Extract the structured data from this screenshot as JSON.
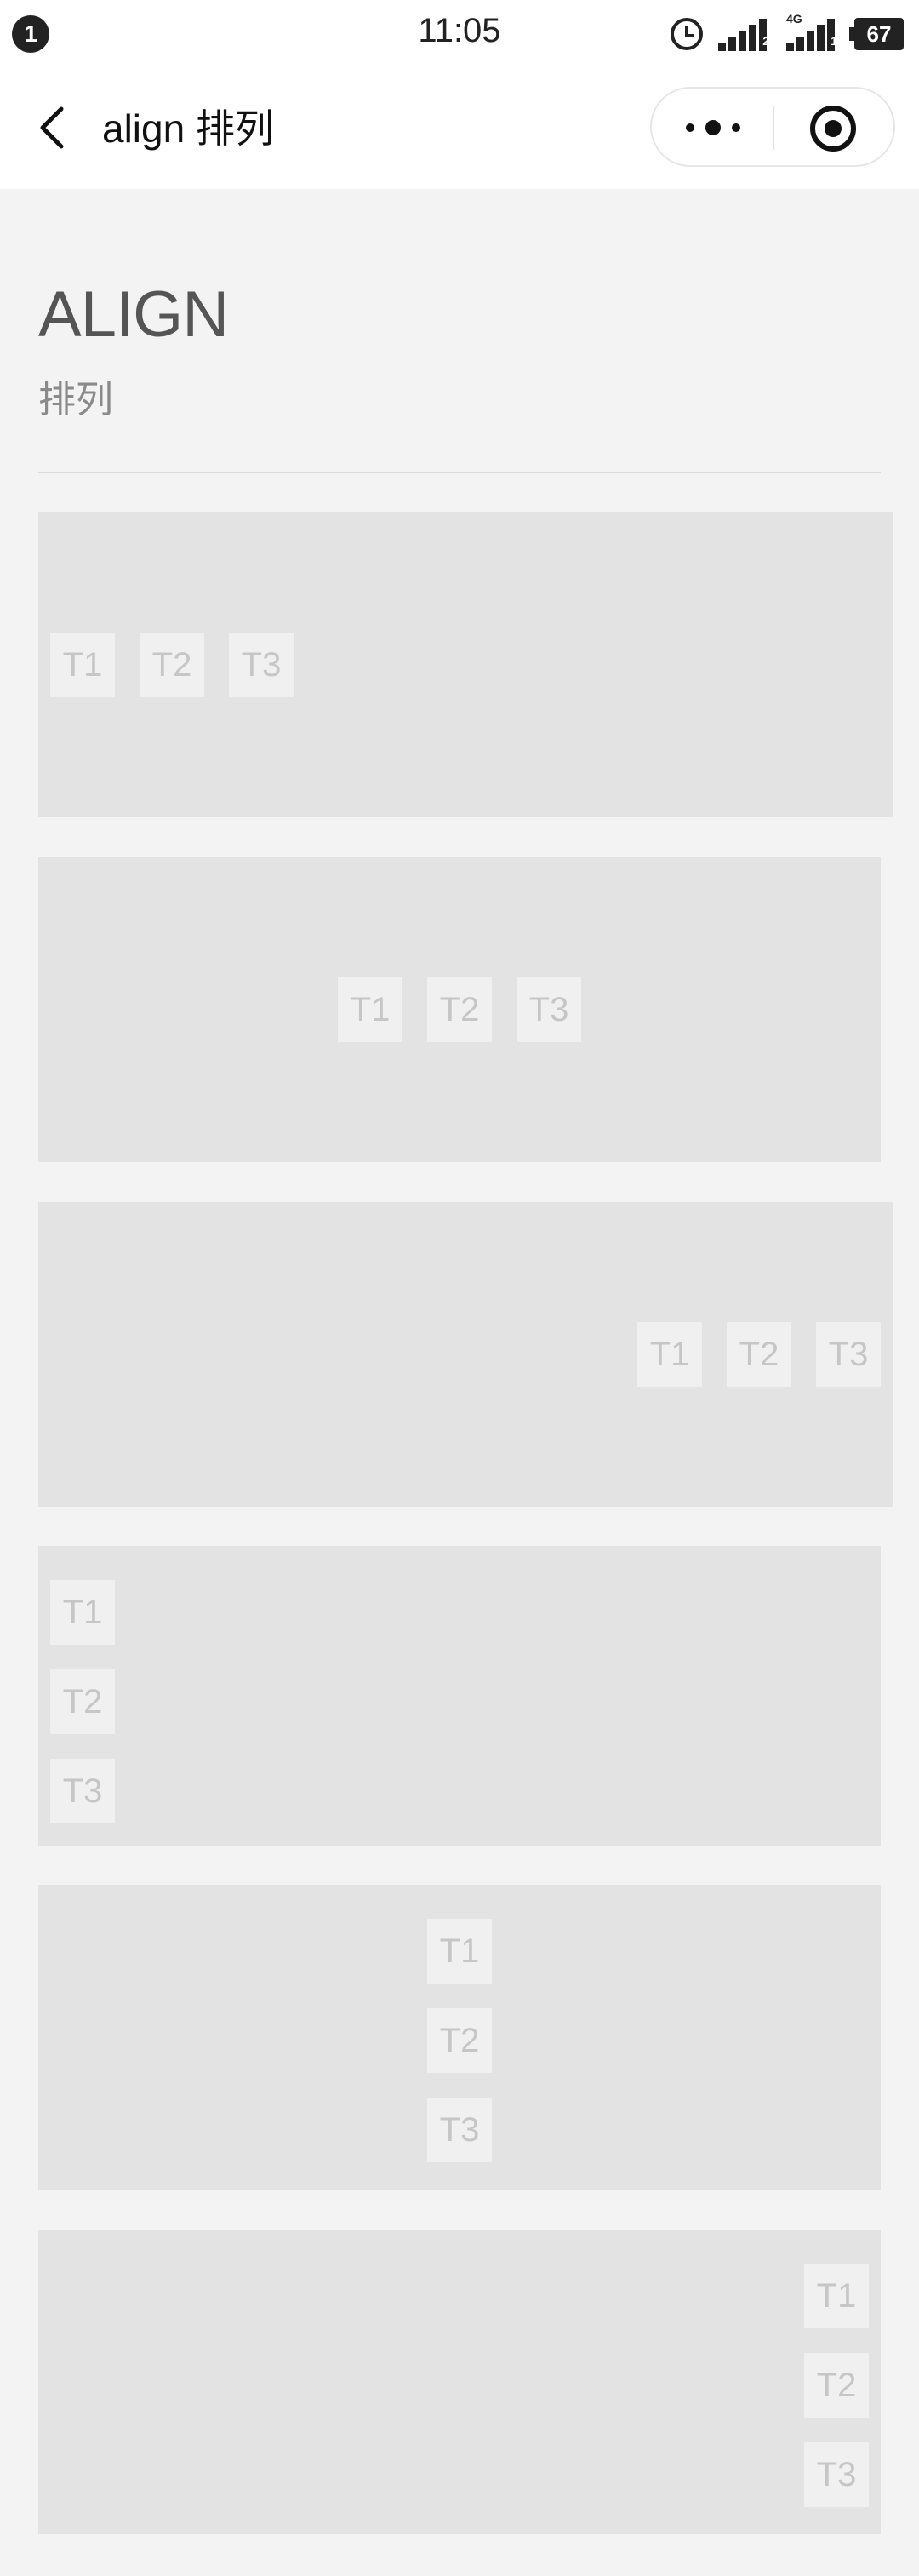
{
  "status_bar": {
    "notification_count": "1",
    "time": "11:05",
    "network_type": "4G",
    "sim1_tag": "2",
    "sim2_tag": "1",
    "battery": "67"
  },
  "nav": {
    "title": "align 排列",
    "back_icon": "chevron-left-icon",
    "more_icon": "more-dots-icon",
    "close_icon": "target-circle-icon"
  },
  "header": {
    "title": "ALIGN",
    "subtitle": "排列"
  },
  "demos": [
    {
      "direction": "row",
      "align": "left",
      "items": [
        "T1",
        "T2",
        "T3"
      ]
    },
    {
      "direction": "row",
      "align": "center",
      "items": [
        "T1",
        "T2",
        "T3"
      ]
    },
    {
      "direction": "row",
      "align": "right",
      "items": [
        "T1",
        "T2",
        "T3"
      ]
    },
    {
      "direction": "column",
      "align": "left",
      "items": [
        "T1",
        "T2",
        "T3"
      ]
    },
    {
      "direction": "column",
      "align": "center",
      "items": [
        "T1",
        "T2",
        "T3"
      ]
    },
    {
      "direction": "column",
      "align": "right",
      "items": [
        "T1",
        "T2",
        "T3"
      ]
    }
  ],
  "colors": {
    "page_background": "#f3f3f3",
    "box_background": "#e3e3e3",
    "item_background": "#f0f0f0",
    "item_text": "#c6c6c6"
  }
}
